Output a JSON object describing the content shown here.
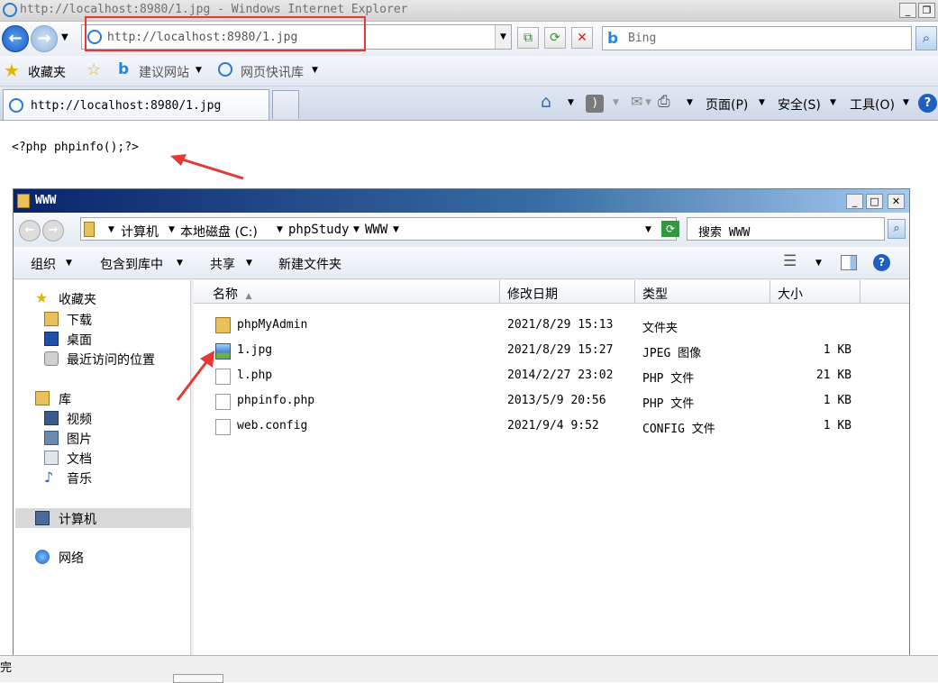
{
  "window": {
    "title": "http://localhost:8980/1.jpg - Windows Internet Explorer"
  },
  "address": {
    "url": "http://localhost:8980/1.jpg",
    "search_placeholder": "Bing"
  },
  "favbar": {
    "favorites": "收藏夹",
    "suggested": "建议网站",
    "web_slice": "网页快讯库"
  },
  "tab": {
    "title": "http://localhost:8980/1.jpg"
  },
  "cmdbar": {
    "page": "页面(P)",
    "safety": "安全(S)",
    "tools": "工具(O)"
  },
  "content": {
    "code": "<?php phpinfo();?>"
  },
  "explorer": {
    "title": "WWW",
    "breadcrumb": [
      "计算机",
      "本地磁盘 (C:)",
      "phpStudy",
      "WWW"
    ],
    "search_placeholder": "搜索 WWW",
    "commands": {
      "organize": "组织",
      "include_library": "包含到库中",
      "share": "共享",
      "new_folder": "新建文件夹"
    },
    "nav": {
      "favorites": "收藏夹",
      "fav_items": [
        "下载",
        "桌面",
        "最近访问的位置"
      ],
      "libraries": "库",
      "lib_items": [
        "视频",
        "图片",
        "文档",
        "音乐"
      ],
      "computer": "计算机",
      "network": "网络"
    },
    "columns": {
      "name": "名称",
      "modified": "修改日期",
      "type": "类型",
      "size": "大小"
    },
    "files": [
      {
        "name": "phpMyAdmin",
        "modified": "2021/8/29 15:13",
        "type": "文件夹",
        "size": "",
        "icon": "folder-icon"
      },
      {
        "name": "1.jpg",
        "modified": "2021/8/29 15:27",
        "type": "JPEG 图像",
        "size": "1 KB",
        "icon": "image-icon"
      },
      {
        "name": "l.php",
        "modified": "2014/2/27 23:02",
        "type": "PHP 文件",
        "size": "21 KB",
        "icon": "file-icon"
      },
      {
        "name": "phpinfo.php",
        "modified": "2013/5/9 20:56",
        "type": "PHP 文件",
        "size": "1 KB",
        "icon": "file-icon"
      },
      {
        "name": "web.config",
        "modified": "2021/9/4 9:52",
        "type": "CONFIG 文件",
        "size": "1 KB",
        "icon": "file-icon"
      }
    ]
  },
  "status": {
    "left": "完"
  },
  "colors": {
    "annotation_red": "#e53935",
    "title_blue": "#0a246a"
  }
}
